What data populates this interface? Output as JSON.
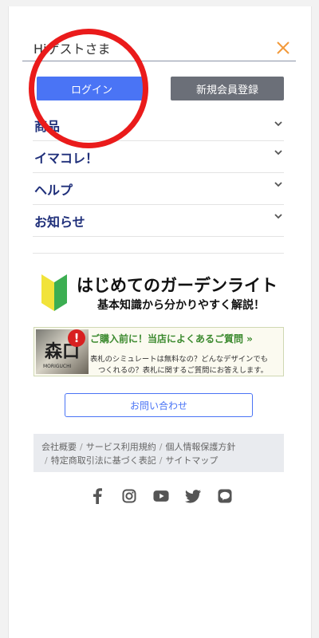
{
  "header": {
    "greeting": "Hiゲストさま"
  },
  "auth": {
    "login_label": "ログイン",
    "signup_label": "新規会員登録"
  },
  "menu": {
    "items": [
      {
        "label": "商品"
      },
      {
        "label": "イマコレ！"
      },
      {
        "label": "ヘルプ"
      },
      {
        "label": "お知らせ"
      }
    ]
  },
  "banner_guide": {
    "title": "はじめてのガーデンライト",
    "subtitle": "基本知識から分かりやすく解説！"
  },
  "banner_faq": {
    "kanji": "森口",
    "brand": "MORIGUCHI",
    "mark": "!",
    "title": "ご購入前に！当店によくあるご質問 »",
    "text_line1": "表札のシミュレートは無料なの？どんなデザインでも",
    "text_line2": "つくれるの？表札に関するご質問にお答えします。"
  },
  "contact": {
    "label": "お問い合わせ"
  },
  "footer_links": {
    "company": "会社概要",
    "terms": "サービス利用規約",
    "privacy": "個人情報保護方針",
    "commerce": "特定商取引法に基づく表記",
    "sitemap": "サイトマップ",
    "separator": "/"
  },
  "social": {
    "icons": [
      "facebook-icon",
      "instagram-icon",
      "youtube-icon",
      "twitter-icon",
      "line-icon"
    ]
  },
  "colors": {
    "login_button": "#4a74f5",
    "signup_button": "#6b6f78",
    "menu_text": "#1f2f7a",
    "close_icon": "#f29a3b",
    "annotation": "#ea1b1b"
  }
}
